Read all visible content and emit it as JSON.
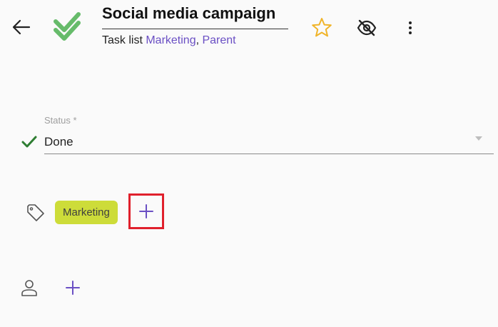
{
  "header": {
    "title": "Social media campaign",
    "subtitle_prefix": "Task list ",
    "list_links": [
      "Marketing",
      "Parent"
    ],
    "separator": ", "
  },
  "icons": {
    "back": "arrow-left-icon",
    "status": "double-check-icon",
    "favorite": "star-outline-icon",
    "visibility": "eye-off-icon",
    "more": "more-vert-icon",
    "tag": "tag-icon",
    "person": "person-icon",
    "add": "plus-icon"
  },
  "status_field": {
    "label": "Status *",
    "value": "Done"
  },
  "tags": [
    {
      "label": "Marketing",
      "color": "#cddc39"
    }
  ],
  "colors": {
    "accent": "#6a4fc4",
    "status_green": "#2e7d32",
    "status_icon_green": "#66bb6a",
    "star": "#f0b429",
    "highlight": "#e0202c",
    "background": "#fafafa"
  }
}
